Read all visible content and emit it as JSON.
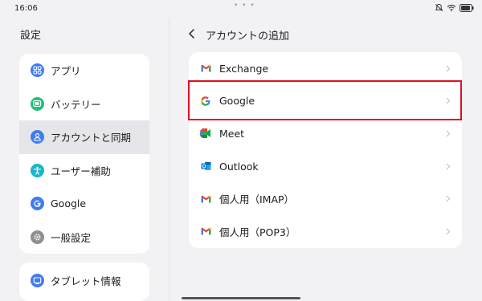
{
  "status": {
    "time": "16:06",
    "dots": "• • •",
    "icons": [
      "mute-icon",
      "wifi-icon",
      "battery-icon"
    ]
  },
  "left": {
    "title": "設定",
    "items": [
      {
        "label": "アプリ",
        "icon": "apps-icon",
        "color": "#3f7cf0"
      },
      {
        "label": "バッテリー",
        "icon": "battery-icon",
        "color": "#22c07a"
      },
      {
        "label": "アカウントと同期",
        "icon": "account-icon",
        "color": "#3f7cf0",
        "selected": true
      },
      {
        "label": "ユーザー補助",
        "icon": "accessibility-icon",
        "color": "#19b5c9"
      },
      {
        "label": "Google",
        "icon": "google-icon",
        "color": "#3f7cf0"
      },
      {
        "label": "一般設定",
        "icon": "gear-icon",
        "color": "#8e8e93"
      }
    ],
    "second_items": [
      {
        "label": "タブレット情報",
        "icon": "tablet-icon",
        "color": "#3f7cf0"
      }
    ]
  },
  "right": {
    "title": "アカウントの追加",
    "accounts": [
      {
        "label": "Exchange",
        "icon": "gmail-icon"
      },
      {
        "label": "Google",
        "icon": "google-icon",
        "highlighted": true
      },
      {
        "label": "Meet",
        "icon": "meet-icon"
      },
      {
        "label": "Outlook",
        "icon": "outlook-icon"
      },
      {
        "label": "個人用（IMAP）",
        "icon": "gmail-icon"
      },
      {
        "label": "個人用（POP3）",
        "icon": "gmail-icon"
      }
    ]
  },
  "colors": {
    "background": "#f2f2f5",
    "card": "#ffffff",
    "selected": "#e6e6ea",
    "highlight": "#e0101e",
    "accent": "#3f7cf0"
  }
}
